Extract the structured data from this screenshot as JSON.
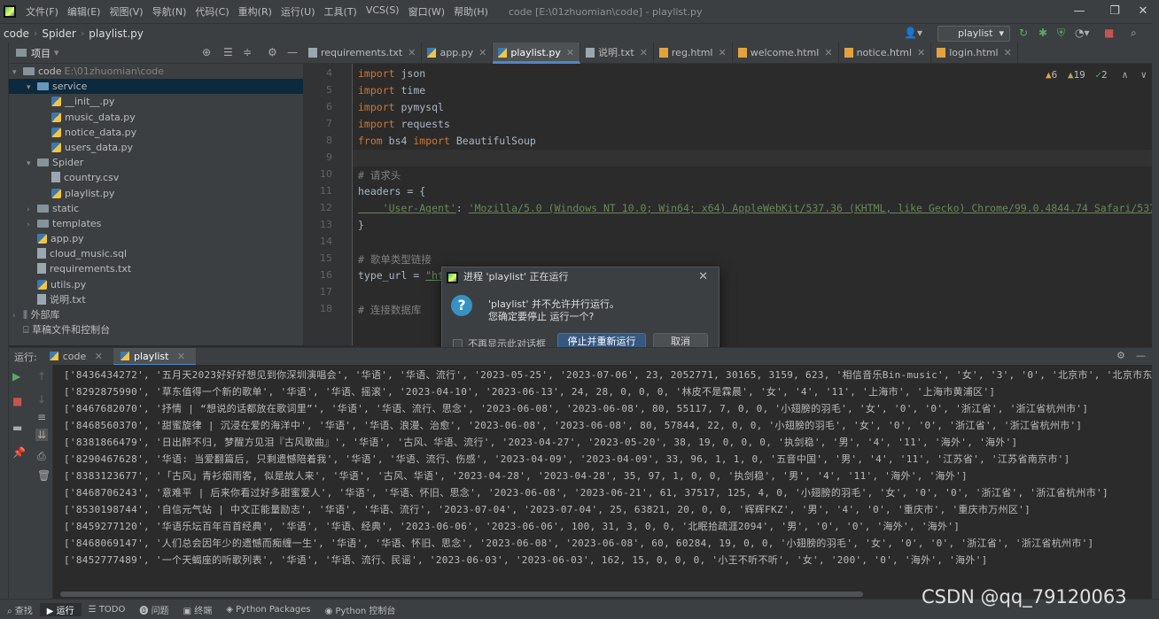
{
  "menubar": {
    "items": [
      "文件(F)",
      "编辑(E)",
      "视图(V)",
      "导航(N)",
      "代码(C)",
      "重构(R)",
      "运行(U)",
      "工具(T)",
      "VCS(S)",
      "窗口(W)",
      "帮助(H)"
    ],
    "window_title": "code [E:\\01zhuomian\\code] - playlist.py",
    "minimize": "—",
    "maximize": "❐",
    "close": "✕"
  },
  "navbar": {
    "crumbs": [
      "code",
      "Spider",
      "playlist.py"
    ],
    "run_config": "playlist"
  },
  "project": {
    "header": "项目",
    "tree": [
      {
        "label": "code",
        "path": "E:\\01zhuomian\\code",
        "kind": "folder",
        "depth": 0,
        "open": true
      },
      {
        "label": "service",
        "kind": "folder-blue",
        "depth": 1,
        "open": true,
        "selected": true
      },
      {
        "label": "__init__.py",
        "kind": "py",
        "depth": 2
      },
      {
        "label": "music_data.py",
        "kind": "py",
        "depth": 2
      },
      {
        "label": "notice_data.py",
        "kind": "py",
        "depth": 2
      },
      {
        "label": "users_data.py",
        "kind": "py",
        "depth": 2
      },
      {
        "label": "Spider",
        "kind": "folder",
        "depth": 1,
        "open": true
      },
      {
        "label": "country.csv",
        "kind": "file",
        "depth": 2
      },
      {
        "label": "playlist.py",
        "kind": "py",
        "depth": 2
      },
      {
        "label": "static",
        "kind": "folder",
        "depth": 1,
        "open": false
      },
      {
        "label": "templates",
        "kind": "folder",
        "depth": 1,
        "open": false
      },
      {
        "label": "app.py",
        "kind": "py",
        "depth": 1
      },
      {
        "label": "cloud_music.sql",
        "kind": "file",
        "depth": 1
      },
      {
        "label": "requirements.txt",
        "kind": "file",
        "depth": 1
      },
      {
        "label": "utils.py",
        "kind": "py",
        "depth": 1
      },
      {
        "label": "说明.txt",
        "kind": "file",
        "depth": 1
      },
      {
        "label": "外部库",
        "kind": "lib",
        "depth": 0,
        "open": false
      },
      {
        "label": "草稿文件和控制台",
        "kind": "scratch",
        "depth": 0
      }
    ]
  },
  "editor": {
    "tabs": [
      {
        "label": "requirements.txt",
        "kind": "txt"
      },
      {
        "label": "app.py",
        "kind": "py"
      },
      {
        "label": "playlist.py",
        "kind": "py",
        "active": true
      },
      {
        "label": "说明.txt",
        "kind": "txt"
      },
      {
        "label": "reg.html",
        "kind": "html"
      },
      {
        "label": "welcome.html",
        "kind": "html"
      },
      {
        "label": "notice.html",
        "kind": "html"
      },
      {
        "label": "login.html",
        "kind": "html"
      }
    ],
    "inspections": {
      "warnings": "6",
      "weak": "19",
      "ok": "2"
    },
    "lines": [
      {
        "n": "4",
        "code": [
          [
            "kw",
            "import"
          ],
          [
            "",
            "json"
          ]
        ]
      },
      {
        "n": "5",
        "code": [
          [
            "kw",
            "import"
          ],
          [
            "",
            "time"
          ]
        ]
      },
      {
        "n": "6",
        "code": [
          [
            "kw",
            "import"
          ],
          [
            "",
            "pymysql"
          ]
        ]
      },
      {
        "n": "7",
        "code": [
          [
            "kw",
            "import"
          ],
          [
            "",
            "requests"
          ]
        ]
      },
      {
        "n": "8",
        "code": [
          [
            "kw",
            "from"
          ],
          [
            "",
            "bs4"
          ],
          [
            "kw",
            "import"
          ],
          [
            "",
            "BeautifulSoup"
          ]
        ]
      },
      {
        "n": "9",
        "code": []
      },
      {
        "n": "10",
        "code": [
          [
            "cm",
            "# 请求头"
          ]
        ]
      },
      {
        "n": "11",
        "code": [
          [
            "",
            "headers = {"
          ]
        ]
      },
      {
        "n": "12",
        "code": [
          [
            "st",
            "    'User-Agent'"
          ],
          [
            "",
            ": "
          ],
          [
            "st",
            "'Mozilla/5.0 (Windows NT 10.0; Win64; x64) AppleWebKit/537.36 (KHTML, like Gecko) Chrome/99.0.4844.74 Safari/537"
          ]
        ]
      },
      {
        "n": "13",
        "code": [
          [
            "",
            "}"
          ]
        ]
      },
      {
        "n": "14",
        "code": []
      },
      {
        "n": "15",
        "code": [
          [
            "cm",
            "# 歌单类型链接"
          ]
        ]
      },
      {
        "n": "16",
        "code": [
          [
            "",
            "type_url = "
          ],
          [
            "st",
            "\"ht"
          ]
        ]
      },
      {
        "n": "17",
        "code": []
      },
      {
        "n": "18",
        "code": [
          [
            "cm",
            "# 连接数据库"
          ]
        ]
      }
    ]
  },
  "dialog": {
    "title": "进程 'playlist' 正在运行",
    "message1": "'playlist' 并不允许并行运行。",
    "message2": "您确定要停止 运行一个?",
    "checkbox": "不再显示此对话框",
    "stop_button": "停止并重新运行",
    "cancel_button": "取消"
  },
  "run_panel": {
    "label": "运行:",
    "tabs": [
      "code",
      "playlist"
    ],
    "active_tab": "playlist",
    "output": [
      "['8436434272', '五月天2023好好好想见到你深圳演唱会', '华语', '华语、流行', '2023-05-25', '2023-07-06', 23, 2052771, 30165, 3159, 623, '相信音乐Bin-music', '女', '3', '0', '北京市', '北京市东城",
      "['8292875990', '草东值得一个新的歌单', '华语', '华语、摇滚', '2023-04-10', '2023-06-13', 24, 28, 0, 0, 0, '林皮不是霖晨', '女', '4', '11', '上海市', '上海市黄浦区']",
      "['8467682070', '抒情 | “想说的话都放在歌词里”', '华语', '华语、流行、思念', '2023-06-08', '2023-06-08', 80, 55117, 7, 0, 0, '小翅膀的羽毛', '女', '0', '0', '浙江省', '浙江省杭州市']",
      "['8468560370', '甜蜜旋律 | 沉浸在爱的海洋中', '华语', '华语、浪漫、治愈', '2023-06-08', '2023-06-08', 80, 57844, 22, 0, 0, '小翅膀的羽毛', '女', '0', '0', '浙江省', '浙江省杭州市']",
      "['8381866479', '日出醉不归, 梦醒方见泪『古风歌曲』', '华语', '古风、华语、流行', '2023-04-27', '2023-05-20', 38, 19, 0, 0, 0, '执剑稳', '男', '4', '11', '海外', '海外']",
      "['8290467628', '华语: 当爱翻篇后, 只剩遗憾陪着我', '华语', '华语、流行、伤感', '2023-04-09', '2023-04-09', 33, 96, 1, 1, 0, '五音中国', '男', '4', '11', '江苏省', '江苏省南京市']",
      "['8383123677', '「古风」青衫烟雨客, 似是故人来', '华语', '古风、华语', '2023-04-28', '2023-04-28', 35, 97, 1, 0, 0, '执剑稳', '男', '4', '11', '海外', '海外']",
      "['8468706243', '意难平 | 后来你看过好多甜蜜爱人', '华语', '华语、怀旧、思念', '2023-06-08', '2023-06-21', 61, 37517, 125, 4, 0, '小翅膀的羽毛', '女', '0', '0', '浙江省', '浙江省杭州市']",
      "['8530198744', '自信元气站 | 中文正能量励志', '华语', '华语、流行', '2023-07-04', '2023-07-04', 25, 63821, 20, 0, 0, '辉辉FKZ', '男', '4', '0', '重庆市', '重庆市万州区']",
      "['8459277120', '华语乐坛百年百首经典', '华语', '华语、经典', '2023-06-06', '2023-06-06', 100, 31, 3, 0, 0, '北眠拾疏涯2094', '男', '0', '0', '海外', '海外']",
      "['8468069147', '人们总会因年少的遗憾而痴缠一生', '华语', '华语、怀旧、思念', '2023-06-08', '2023-06-08', 60, 60284, 19, 0, 0, '小翅膀的羽毛', '女', '0', '0', '浙江省', '浙江省杭州市']",
      "['8452777489', '一个天蝎座的听歌列表', '华语', '华语、流行、民谣', '2023-06-03', '2023-06-03', 162, 15, 0, 0, 0, '小王不听不听', '女', '200', '0', '海外', '海外']"
    ]
  },
  "statusbar": {
    "items": [
      {
        "label": "查找",
        "icon": "search-icon"
      },
      {
        "label": "运行",
        "icon": "play-icon",
        "active": true
      },
      {
        "label": "TODO",
        "icon": "list-icon"
      },
      {
        "label": "问题",
        "icon": "problems-icon"
      },
      {
        "label": "终端",
        "icon": "terminal-icon"
      },
      {
        "label": "Python Packages",
        "icon": "packages-icon"
      },
      {
        "label": "Python 控制台",
        "icon": "console-icon"
      }
    ]
  },
  "watermark": "CSDN @qq_79120063",
  "colors": {
    "keyword": "#cc7832",
    "comment": "#808080",
    "string": "#6a8759",
    "accent": "#4a88c7",
    "primary_button": "#365880"
  }
}
